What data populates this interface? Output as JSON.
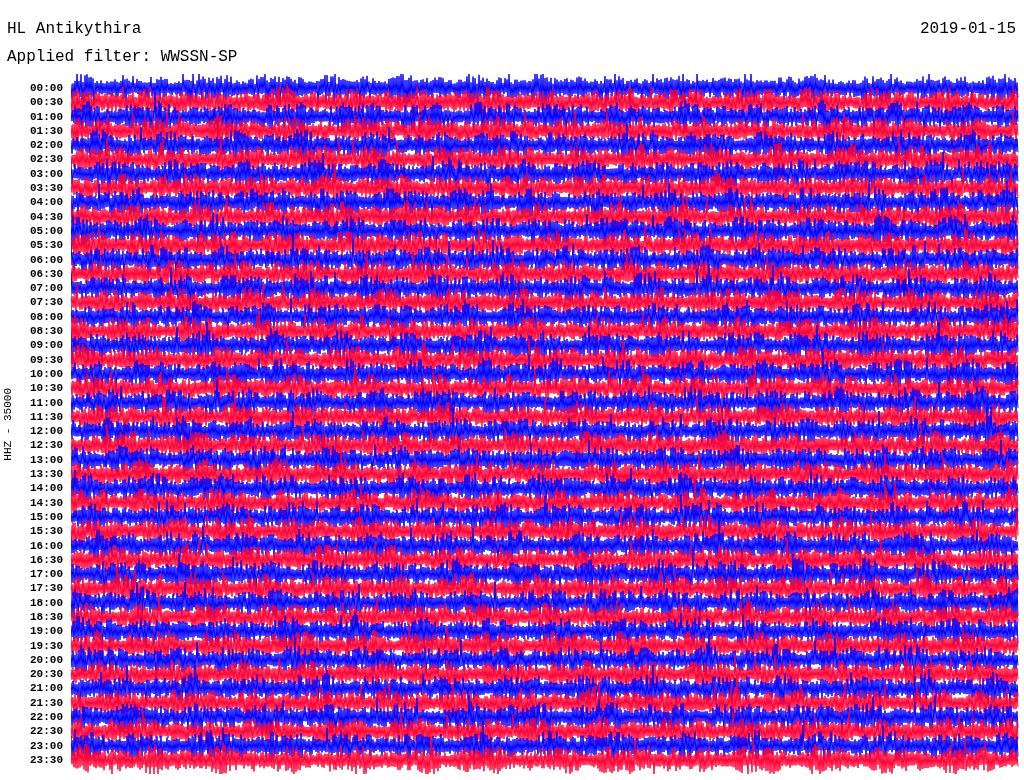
{
  "header": {
    "station": "HL Antikythira",
    "date": "2019-01-15",
    "filter": "Applied filter: WWSSN-SP"
  },
  "channel_label": "HHZ - 35000",
  "traces": [
    {
      "time": "00:00",
      "color": "#0000ff"
    },
    {
      "time": "00:30",
      "color": "#ff0033"
    },
    {
      "time": "01:00",
      "color": "#0000ff"
    },
    {
      "time": "01:30",
      "color": "#ff0033"
    },
    {
      "time": "02:00",
      "color": "#0000ff"
    },
    {
      "time": "02:30",
      "color": "#ff0033"
    },
    {
      "time": "03:00",
      "color": "#0000ff"
    },
    {
      "time": "03:30",
      "color": "#ff0033"
    },
    {
      "time": "04:00",
      "color": "#0000ff"
    },
    {
      "time": "04:30",
      "color": "#ff0033"
    },
    {
      "time": "05:00",
      "color": "#0000ff"
    },
    {
      "time": "05:30",
      "color": "#ff0033"
    },
    {
      "time": "06:00",
      "color": "#0000ff"
    },
    {
      "time": "06:30",
      "color": "#ff0033"
    },
    {
      "time": "07:00",
      "color": "#0000ff"
    },
    {
      "time": "07:30",
      "color": "#ff0033"
    },
    {
      "time": "08:00",
      "color": "#0000ff"
    },
    {
      "time": "08:30",
      "color": "#ff0033"
    },
    {
      "time": "09:00",
      "color": "#0000ff"
    },
    {
      "time": "09:30",
      "color": "#ff0033"
    },
    {
      "time": "10:00",
      "color": "#0000ff"
    },
    {
      "time": "10:30",
      "color": "#ff0033"
    },
    {
      "time": "11:00",
      "color": "#0000ff"
    },
    {
      "time": "11:30",
      "color": "#ff0033"
    },
    {
      "time": "12:00",
      "color": "#0000ff"
    },
    {
      "time": "12:30",
      "color": "#ff0033"
    },
    {
      "time": "13:00",
      "color": "#0000ff"
    },
    {
      "time": "13:30",
      "color": "#ff0033"
    },
    {
      "time": "14:00",
      "color": "#0000ff"
    },
    {
      "time": "14:30",
      "color": "#ff0033"
    },
    {
      "time": "15:00",
      "color": "#0000ff"
    },
    {
      "time": "15:30",
      "color": "#ff0033"
    },
    {
      "time": "16:00",
      "color": "#0000ff"
    },
    {
      "time": "16:30",
      "color": "#ff0033"
    },
    {
      "time": "17:00",
      "color": "#0000ff"
    },
    {
      "time": "17:30",
      "color": "#ff0033"
    },
    {
      "time": "18:00",
      "color": "#0000ff"
    },
    {
      "time": "18:30",
      "color": "#ff0033"
    },
    {
      "time": "19:00",
      "color": "#0000ff"
    },
    {
      "time": "19:30",
      "color": "#ff0033"
    },
    {
      "time": "20:00",
      "color": "#0000ff"
    },
    {
      "time": "20:30",
      "color": "#ff0033"
    },
    {
      "time": "21:00",
      "color": "#0000ff"
    },
    {
      "time": "21:30",
      "color": "#ff0033"
    },
    {
      "time": "22:00",
      "color": "#0000ff"
    },
    {
      "time": "22:30",
      "color": "#ff0033"
    },
    {
      "time": "23:00",
      "color": "#0000ff"
    },
    {
      "time": "23:30",
      "color": "#ff0033"
    }
  ]
}
